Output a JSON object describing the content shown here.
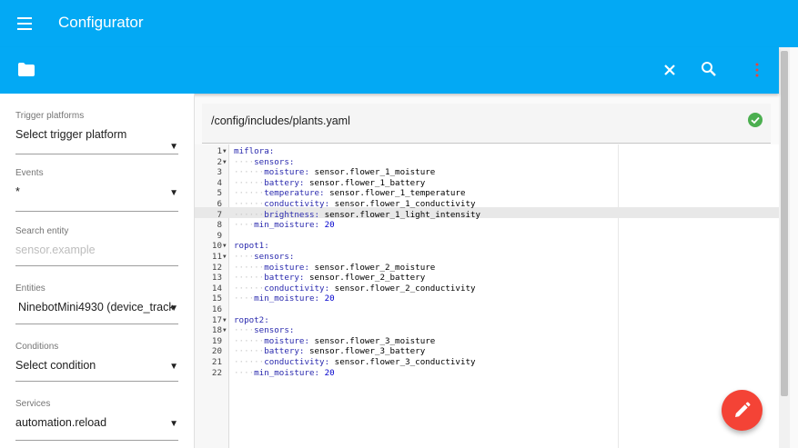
{
  "app": {
    "title": "Configurator"
  },
  "file": {
    "path": "/config/includes/plants.yaml"
  },
  "sidebar": {
    "trigger_platforms": {
      "label": "Trigger platforms",
      "value": "Select trigger platform"
    },
    "events": {
      "label": "Events",
      "value": "*"
    },
    "search_entity": {
      "label": "Search entity",
      "placeholder": "sensor.example"
    },
    "entities": {
      "label": "Entities",
      "value": "NinebotMini4930 (device_track…"
    },
    "conditions": {
      "label": "Conditions",
      "value": "Select condition"
    },
    "services": {
      "label": "Services",
      "value": "automation.reload"
    }
  },
  "icons": {
    "menu": "hamburger-menu-icon",
    "folder": "folder-icon",
    "close": "close-icon",
    "search": "search-icon",
    "more": "more-vert-icon",
    "status": "check-circle-icon",
    "fab": "pencil-icon"
  },
  "colors": {
    "primary": "#03a9f4",
    "fab": "#f44336",
    "ok": "#4caf50",
    "yaml_key": "#2a2aae"
  },
  "editor": {
    "active_line": 7,
    "lines": [
      {
        "n": "1",
        "fold": true,
        "indent": "",
        "key": "miflora:",
        "val": ""
      },
      {
        "n": "2",
        "fold": true,
        "indent": "····",
        "key": "sensors:",
        "val": ""
      },
      {
        "n": "3",
        "fold": false,
        "indent": "······",
        "key": "moisture:",
        "val": " sensor.flower_1_moisture"
      },
      {
        "n": "4",
        "fold": false,
        "indent": "······",
        "key": "battery:",
        "val": " sensor.flower_1_battery"
      },
      {
        "n": "5",
        "fold": false,
        "indent": "······",
        "key": "temperature:",
        "val": " sensor.flower_1_temperature"
      },
      {
        "n": "6",
        "fold": false,
        "indent": "······",
        "key": "conductivity:",
        "val": " sensor.flower_1_conductivity"
      },
      {
        "n": "7",
        "fold": false,
        "indent": "······",
        "key": "brightness:",
        "val": " sensor.flower_1_light_intensity"
      },
      {
        "n": "8",
        "fold": false,
        "indent": "····",
        "key": "min_moisture:",
        "val": " 20"
      },
      {
        "n": "9",
        "fold": false,
        "indent": "",
        "key": "",
        "val": ""
      },
      {
        "n": "10",
        "fold": true,
        "indent": "",
        "key": "ropot1:",
        "val": ""
      },
      {
        "n": "11",
        "fold": true,
        "indent": "····",
        "key": "sensors:",
        "val": ""
      },
      {
        "n": "12",
        "fold": false,
        "indent": "······",
        "key": "moisture:",
        "val": " sensor.flower_2_moisture"
      },
      {
        "n": "13",
        "fold": false,
        "indent": "······",
        "key": "battery:",
        "val": " sensor.flower_2_battery"
      },
      {
        "n": "14",
        "fold": false,
        "indent": "······",
        "key": "conductivity:",
        "val": " sensor.flower_2_conductivity"
      },
      {
        "n": "15",
        "fold": false,
        "indent": "····",
        "key": "min_moisture:",
        "val": " 20"
      },
      {
        "n": "16",
        "fold": false,
        "indent": "",
        "key": "",
        "val": ""
      },
      {
        "n": "17",
        "fold": true,
        "indent": "",
        "key": "ropot2:",
        "val": ""
      },
      {
        "n": "18",
        "fold": true,
        "indent": "····",
        "key": "sensors:",
        "val": ""
      },
      {
        "n": "19",
        "fold": false,
        "indent": "······",
        "key": "moisture:",
        "val": " sensor.flower_3_moisture"
      },
      {
        "n": "20",
        "fold": false,
        "indent": "······",
        "key": "battery:",
        "val": " sensor.flower_3_battery"
      },
      {
        "n": "21",
        "fold": false,
        "indent": "······",
        "key": "conductivity:",
        "val": " sensor.flower_3_conductivity"
      },
      {
        "n": "22",
        "fold": false,
        "indent": "····",
        "key": "min_moisture:",
        "val": " 20"
      }
    ]
  }
}
